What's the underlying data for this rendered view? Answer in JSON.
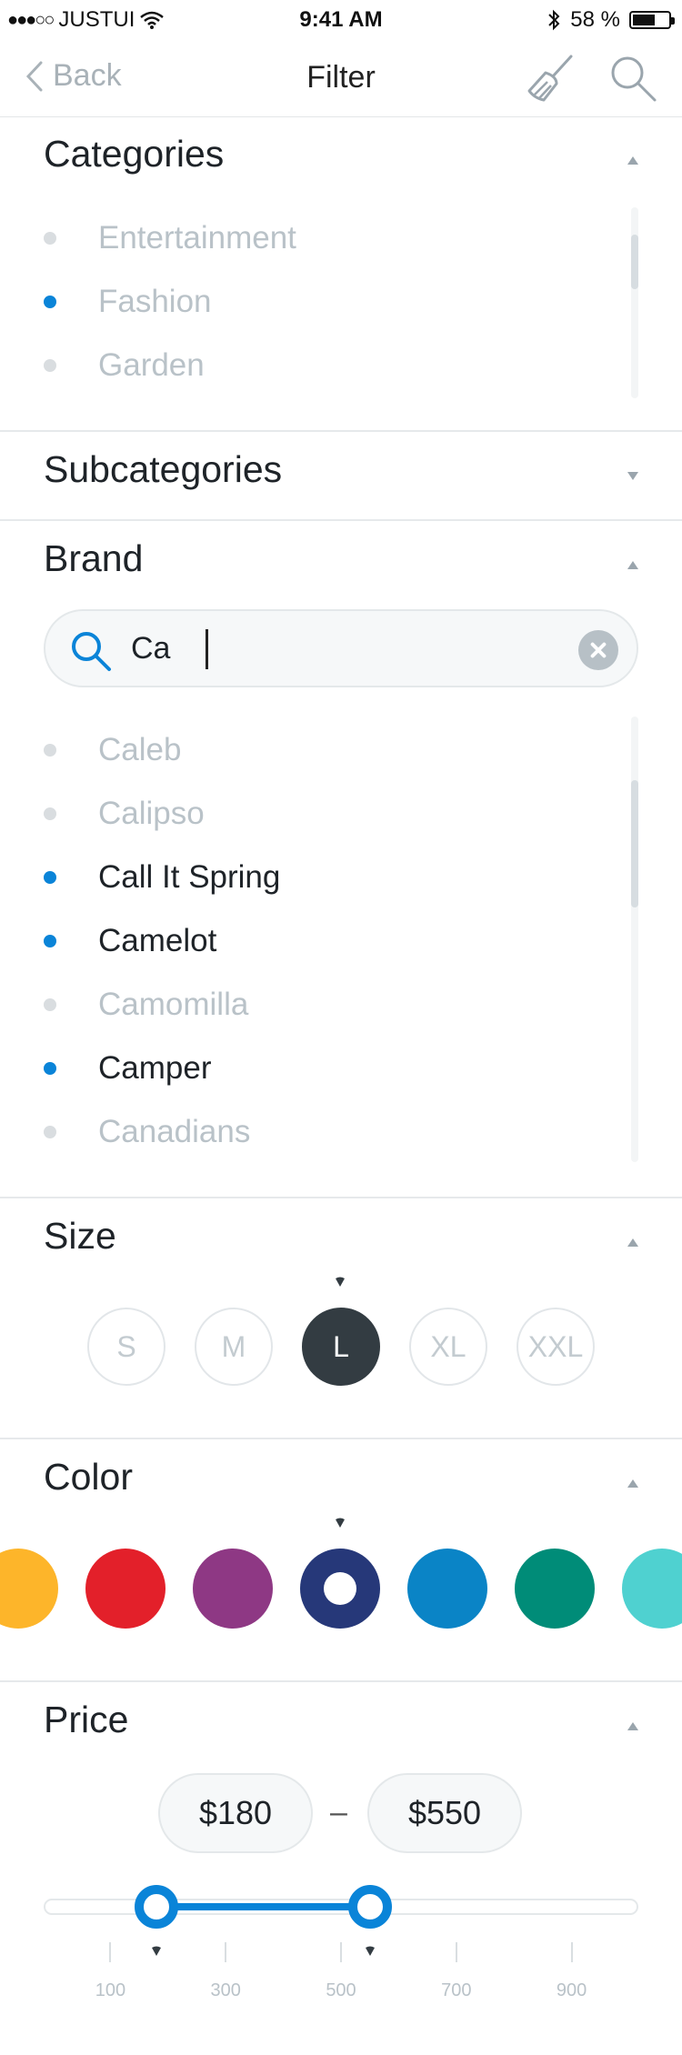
{
  "status": {
    "carrier": "JUSTUI",
    "time": "9:41 AM",
    "battery": "58 %",
    "signal_dots": "●●●○○"
  },
  "nav": {
    "back_label": "Back",
    "title": "Filter",
    "icons": [
      "broom-icon",
      "search-icon"
    ]
  },
  "categories": {
    "title": "Categories",
    "items": [
      {
        "label": "Entertainment",
        "selected": false
      },
      {
        "label": "Fashion",
        "selected": true
      },
      {
        "label": "Garden",
        "selected": false
      }
    ]
  },
  "subcategories": {
    "title": "Subcategories"
  },
  "brand": {
    "title": "Brand",
    "search_value": "Ca",
    "items": [
      {
        "label": "Caleb",
        "selected": false
      },
      {
        "label": "Calipso",
        "selected": false
      },
      {
        "label": "Call It Spring",
        "selected": true
      },
      {
        "label": "Camelot",
        "selected": true
      },
      {
        "label": "Camomilla",
        "selected": false
      },
      {
        "label": "Camper",
        "selected": true
      },
      {
        "label": "Canadians",
        "selected": false
      }
    ]
  },
  "size": {
    "title": "Size",
    "options": [
      "S",
      "M",
      "L",
      "XL",
      "XXL"
    ],
    "selected": "L"
  },
  "color": {
    "title": "Color",
    "swatches": [
      "#FDB52A",
      "#E3202A",
      "#8E3884",
      "#263879",
      "#0A84C6",
      "#008C78",
      "#4FD1D0"
    ],
    "selected_index": 3
  },
  "price": {
    "title": "Price",
    "min_label": "$180",
    "max_label": "$550",
    "separator": "–",
    "min": 180,
    "max": 550,
    "scale_min": 0,
    "scale_max": 1000,
    "ticks": [
      "100",
      "300",
      "500",
      "700",
      "900"
    ]
  },
  "colors": {
    "accent": "#0A84D8",
    "muted_text": "#B9C2C8",
    "dark": "#333C42"
  }
}
